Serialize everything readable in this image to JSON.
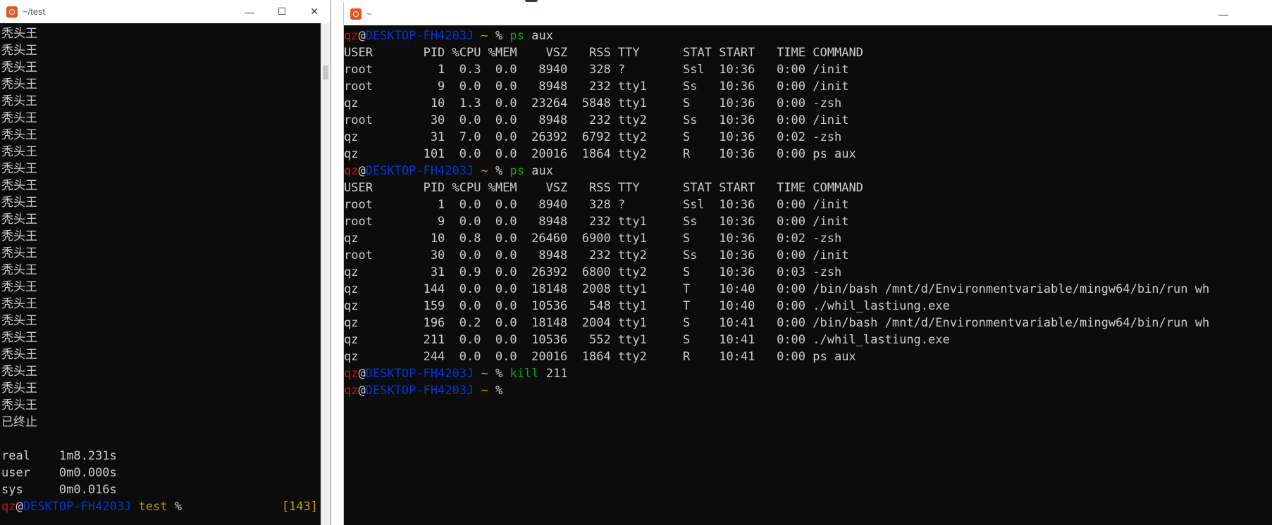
{
  "left_window": {
    "title": "~/test",
    "controls": {
      "minimize": "—",
      "maximize": "☐",
      "close": "✕"
    },
    "repeated_line": "秃头王",
    "repeat_count": 23,
    "terminated": "已终止",
    "timing": [
      {
        "label": "real",
        "value": "1m8.231s"
      },
      {
        "label": "user",
        "value": "0m0.000s"
      },
      {
        "label": "sys",
        "value": "0m0.016s"
      }
    ],
    "prompt": {
      "user": "qz",
      "at": "@",
      "host": "DESKTOP-FH4203J",
      "cwd": "test",
      "symbol": "%",
      "return_code": "[143]"
    }
  },
  "right_window": {
    "title": "~",
    "controls": {
      "minimize": "—"
    },
    "prompt": {
      "user": "qz",
      "at": "@",
      "host": "DESKTOP-FH4203J",
      "cwd": "~",
      "symbol": "%"
    },
    "blocks": [
      {
        "command": "ps",
        "args": "aux",
        "header": "USER       PID %CPU %MEM    VSZ   RSS TTY      STAT START   TIME COMMAND",
        "rows": [
          "root         1  0.3  0.0   8940   328 ?        Ssl  10:36   0:00 /init",
          "root         9  0.0  0.0   8948   232 tty1     Ss   10:36   0:00 /init",
          "qz          10  1.3  0.0  23264  5848 tty1     S    10:36   0:00 -zsh",
          "root        30  0.0  0.0   8948   232 tty2     Ss   10:36   0:00 /init",
          "qz          31  7.0  0.0  26392  6792 tty2     S    10:36   0:02 -zsh",
          "qz         101  0.0  0.0  20016  1864 tty2     R    10:36   0:00 ps aux"
        ]
      },
      {
        "command": "ps",
        "args": "aux",
        "header": "USER       PID %CPU %MEM    VSZ   RSS TTY      STAT START   TIME COMMAND",
        "rows": [
          "root         1  0.0  0.0   8940   328 ?        Ssl  10:36   0:00 /init",
          "root         9  0.0  0.0   8948   232 tty1     Ss   10:36   0:00 /init",
          "qz          10  0.8  0.0  26460  6900 tty1     S    10:36   0:02 -zsh",
          "root        30  0.0  0.0   8948   232 tty2     Ss   10:36   0:00 /init",
          "qz          31  0.9  0.0  26392  6800 tty2     S    10:36   0:03 -zsh",
          "qz         144  0.0  0.0  18148  2008 tty1     T    10:40   0:00 /bin/bash /mnt/d/Environmentvariable/mingw64/bin/run wh",
          "qz         159  0.0  0.0  10536   548 tty1     T    10:40   0:00 ./whil_lastiung.exe",
          "qz         196  0.2  0.0  18148  2004 tty1     S    10:41   0:00 /bin/bash /mnt/d/Environmentvariable/mingw64/bin/run wh",
          "qz         211  0.0  0.0  10536   552 tty1     S    10:41   0:00 ./whil_lastiung.exe",
          "qz         244  0.0  0.0  20016  1864 tty2     R    10:41   0:00 ps aux"
        ]
      },
      {
        "command": "kill",
        "args": "211",
        "header": null,
        "rows": []
      }
    ]
  },
  "colors": {
    "terminal_bg": "#0c0c0c",
    "terminal_fg": "#cccccc",
    "prompt_user": "#c50f1f",
    "prompt_host": "#0037da",
    "prompt_cwd": "#c19c00",
    "command": "#13a10e",
    "app_icon": "#e95420"
  }
}
